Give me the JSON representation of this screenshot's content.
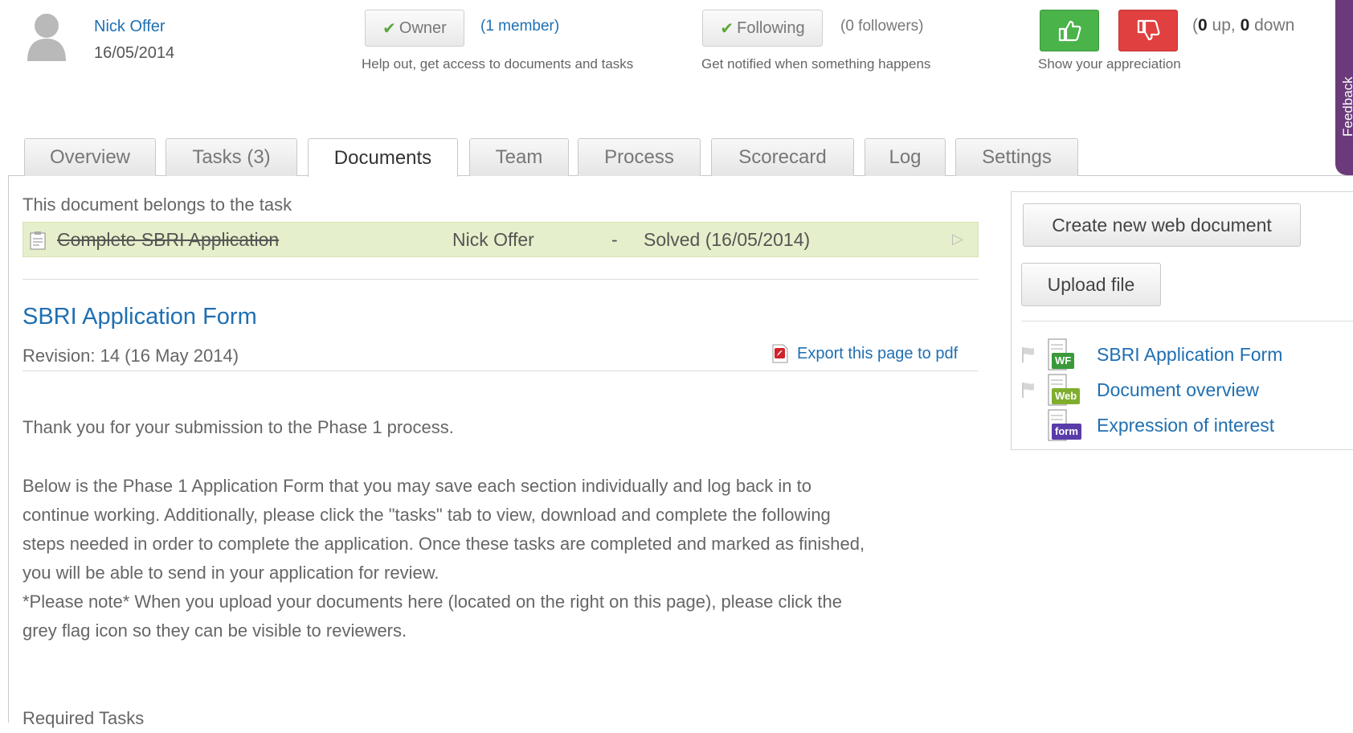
{
  "header": {
    "author": {
      "name": "Nick Offer",
      "date": "16/05/2014"
    },
    "owner": {
      "label": "Owner",
      "count": "(1 member)",
      "help": "Help out, get access to documents and tasks"
    },
    "following": {
      "label": "Following",
      "count": "(0 followers)",
      "help": "Get notified when something happens"
    },
    "votes": {
      "up_count": "0",
      "up_word": "up,",
      "down_count": "0",
      "down_word": "down",
      "help": "Show your appreciation"
    },
    "feedback_label": "Feedback"
  },
  "tabs": [
    {
      "label": "Overview"
    },
    {
      "label": "Tasks (3)"
    },
    {
      "label": "Documents"
    },
    {
      "label": "Team"
    },
    {
      "label": "Process"
    },
    {
      "label": "Scorecard"
    },
    {
      "label": "Log"
    },
    {
      "label": "Settings"
    }
  ],
  "active_tab": "Documents",
  "main": {
    "belongs_label": "This document belongs to the task",
    "task": {
      "name": "Complete SBRI Application",
      "owner": "Nick Offer",
      "dash": "-",
      "status": "Solved (16/05/2014)"
    },
    "doc_title": "SBRI Application Form",
    "revision": "Revision: 14 (16 May 2014)",
    "export_label": "Export this page to pdf",
    "para1": "Thank you for your submission to the Phase 1 process.",
    "para2_lines": [
      "Below is the Phase 1 Application Form that you may save each section individually and log back in to",
      "continue working. Additionally, please click the \"tasks\" tab to view, download and complete the following",
      "steps needed in order to complete the application. Once these tasks are completed and marked as finished,",
      "you will be able to send in your application for review.",
      "*Please note* When you upload your documents here (located on the right on this page), please click the",
      "grey flag icon so they can be visible to reviewers."
    ],
    "required_tasks": "Required Tasks"
  },
  "panel": {
    "create_label": "Create new web document",
    "upload_label": "Upload file",
    "documents": [
      {
        "label": "SBRI Application Form",
        "badge": "WF",
        "badge_color": "#3a9a3a",
        "flag": true
      },
      {
        "label": "Document overview",
        "badge": "Web",
        "badge_color": "#7fae2e",
        "flag": true
      },
      {
        "label": "Expression of interest",
        "badge": "form",
        "badge_color": "#5a3ca8",
        "flag": false
      }
    ]
  },
  "colors": {
    "link": "#1f6fb2",
    "task_row_bg": "#e6efcb",
    "vote_up": "#4ab34a",
    "vote_down": "#e04040",
    "feedback_tab": "#6b3a7a"
  }
}
